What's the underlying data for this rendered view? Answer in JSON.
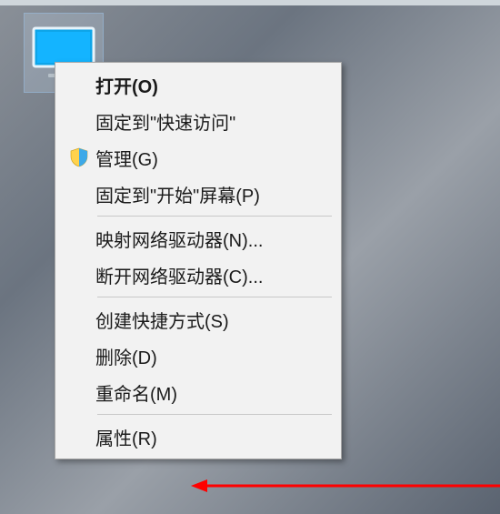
{
  "desktop": {
    "icon_name": "this-pc"
  },
  "menu": {
    "items": [
      {
        "label": "打开(O)",
        "bold": true,
        "icon": ""
      },
      {
        "label": "固定到\"快速访问\"",
        "bold": false,
        "icon": ""
      },
      {
        "label": "管理(G)",
        "bold": false,
        "icon": "shield"
      },
      {
        "label": "固定到\"开始\"屏幕(P)",
        "bold": false,
        "icon": ""
      },
      {
        "separator": true
      },
      {
        "label": "映射网络驱动器(N)...",
        "bold": false,
        "icon": ""
      },
      {
        "label": "断开网络驱动器(C)...",
        "bold": false,
        "icon": ""
      },
      {
        "separator": true
      },
      {
        "label": "创建快捷方式(S)",
        "bold": false,
        "icon": ""
      },
      {
        "label": "删除(D)",
        "bold": false,
        "icon": ""
      },
      {
        "label": "重命名(M)",
        "bold": false,
        "icon": ""
      },
      {
        "separator": true
      },
      {
        "label": "属性(R)",
        "bold": false,
        "icon": ""
      }
    ]
  },
  "annotation": {
    "arrow_target": "属性(R)"
  }
}
